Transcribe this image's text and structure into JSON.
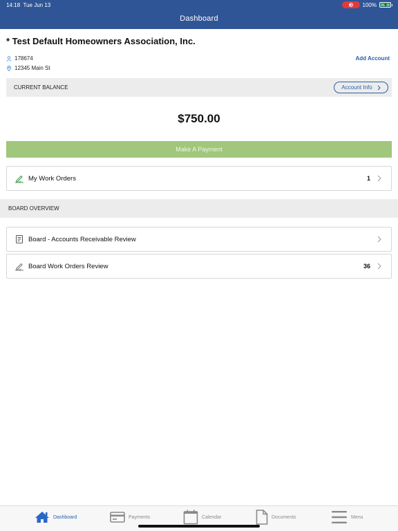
{
  "status_bar": {
    "time": "14:18",
    "date": "Tue Jun 13",
    "battery": "100%"
  },
  "header": {
    "title": "Dashboard"
  },
  "account": {
    "name": "* Test Default Homeowners Association, Inc.",
    "number": "178674",
    "address": "12345 Main St",
    "add_account_label": "Add Account"
  },
  "balance": {
    "label": "CURRENT BALANCE",
    "account_info_label": "Account Info",
    "amount": "$750.00"
  },
  "payment": {
    "button_label": "Make A Payment"
  },
  "work_orders": {
    "label": "My Work Orders",
    "count": "1"
  },
  "board_overview": {
    "section_title": "BOARD OVERVIEW",
    "items": [
      {
        "label": "Board - Accounts Receivable Review",
        "count": "",
        "icon": "document-icon"
      },
      {
        "label": "Board Work Orders Review",
        "count": "36",
        "icon": "pen-icon"
      }
    ]
  },
  "tabs": [
    {
      "label": "Dashboard",
      "icon": "home-icon",
      "active": true
    },
    {
      "label": "Payments",
      "icon": "credit-card-icon",
      "active": false
    },
    {
      "label": "Calendar",
      "icon": "calendar-icon",
      "active": false
    },
    {
      "label": "Documents",
      "icon": "document-icon",
      "active": false
    },
    {
      "label": "Menu",
      "icon": "hamburger-icon",
      "active": false
    }
  ],
  "colors": {
    "header_bg": "#2f5596",
    "accent_blue": "#2a5fa8",
    "payment_green": "#a0c77b",
    "icon_green": "#3a9a48"
  }
}
